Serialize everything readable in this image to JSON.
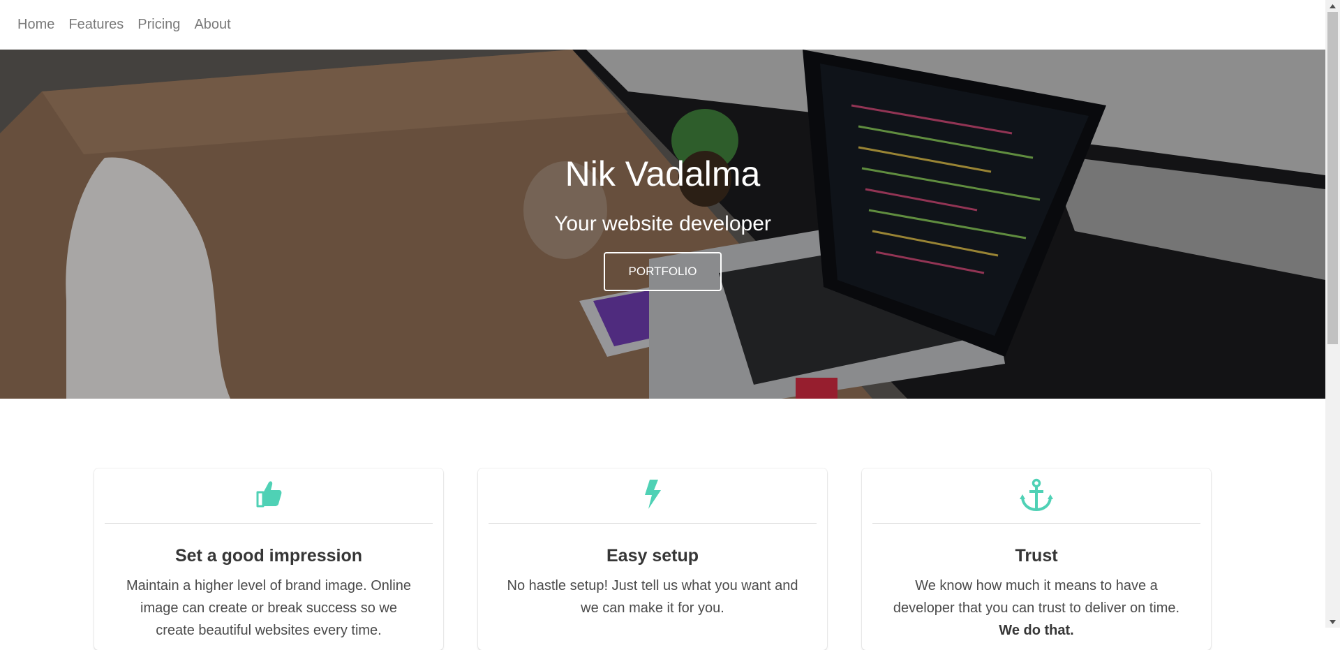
{
  "navbar": {
    "links": [
      "Home",
      "Features",
      "Pricing",
      "About"
    ]
  },
  "hero": {
    "title": "Nik Vadalma",
    "subtitle": "Your website developer",
    "button_label": "PORTFOLIO"
  },
  "features": [
    {
      "icon": "thumbs-up-icon",
      "title": "Set a good impression",
      "text": "Maintain a higher level of brand image. Online image can create or break success so we create beautiful websites every time."
    },
    {
      "icon": "bolt-icon",
      "title": "Easy setup",
      "text": "No hastle setup! Just tell us what you want and we can make it for you."
    },
    {
      "icon": "anchor-icon",
      "title": "Trust",
      "text": "We know how much it means to have a developer that you can trust to deliver on time.",
      "text_bold": "We do that."
    }
  ],
  "colors": {
    "accent": "#4fd1b5",
    "nav_text": "#7a7a7a",
    "hero_text": "#ffffff"
  }
}
